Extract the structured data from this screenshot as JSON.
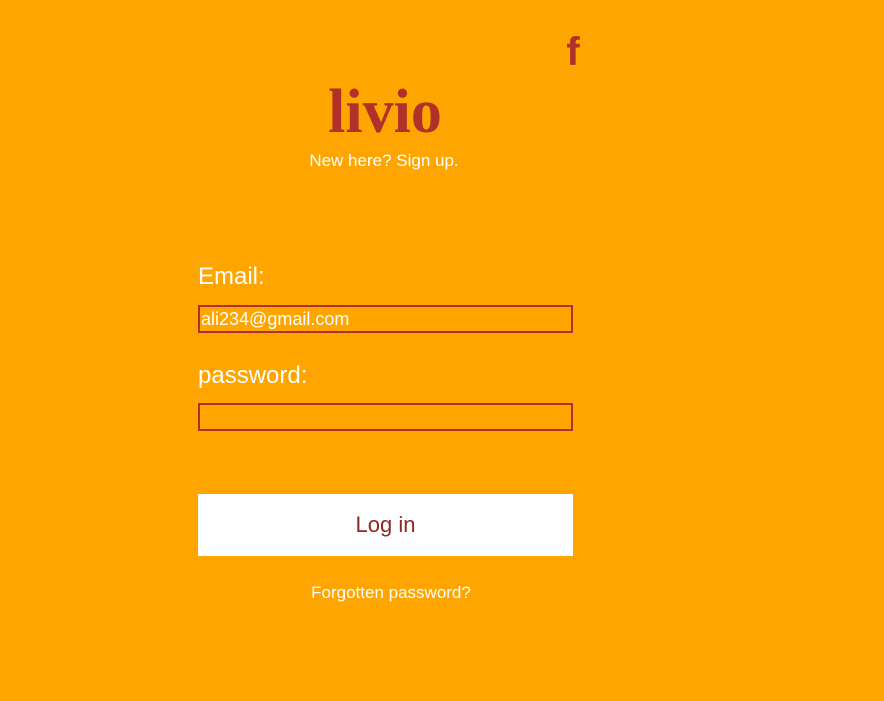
{
  "header": {
    "facebook_icon": "facebook-icon",
    "facebook_glyph": "f",
    "brand": "livio",
    "signup_text": "New here? Sign up."
  },
  "form": {
    "email_label": "Email:",
    "email_value": "ali234@gmail.com",
    "password_label": "password:",
    "password_value": "",
    "login_label": "Log in",
    "forgot_text": "Forgotten password?"
  },
  "colors": {
    "background": "#FFA500",
    "accent": "#B0302A",
    "button_text": "#8B2A24",
    "text": "#FFFFFF",
    "button_bg": "#FFFFFF"
  }
}
